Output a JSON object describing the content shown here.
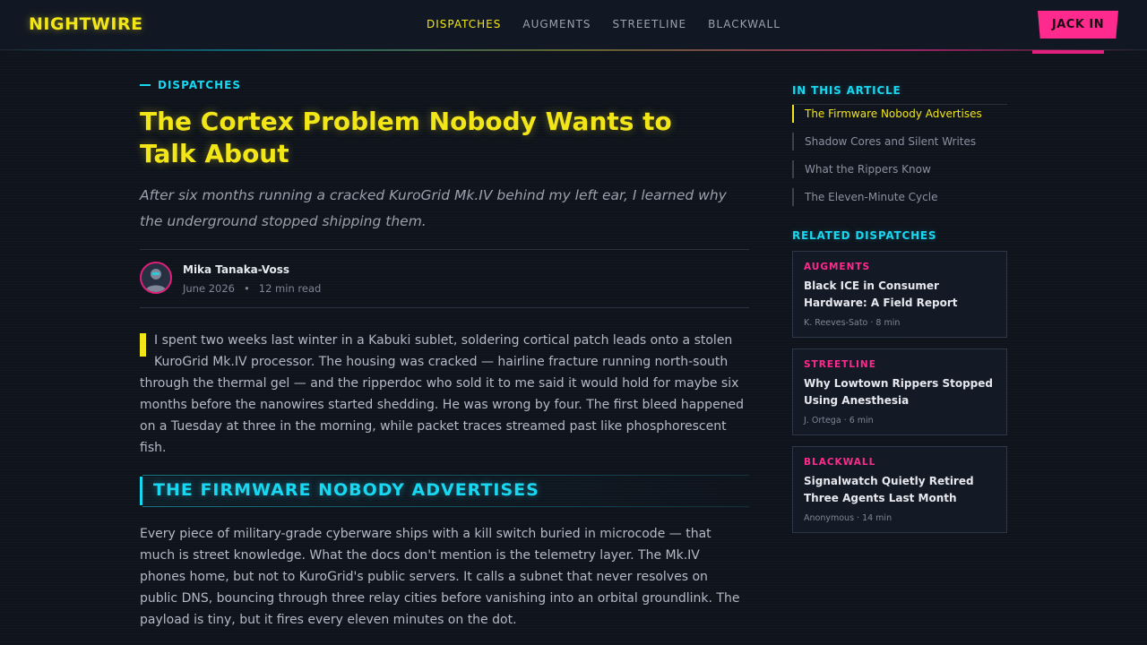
{
  "header": {
    "logo": "NIGHTWIRE",
    "nav": [
      {
        "label": "DISPATCHES",
        "active": true
      },
      {
        "label": "AUGMENTS",
        "active": false
      },
      {
        "label": "STREETLINE",
        "active": false
      },
      {
        "label": "BLACKWALL",
        "active": false
      }
    ],
    "cta_label": "JACK IN"
  },
  "article": {
    "kicker": "DISPATCHES",
    "title": "The Cortex Problem Nobody Wants to Talk About",
    "deck": "After six months running a cracked KuroGrid Mk.IV behind my left ear, I learned why the underground stopped shipping them.",
    "author": "Mika Tanaka-Voss",
    "date": "June 2026",
    "read_time": "12 min read",
    "lead": "I spent two weeks last winter in a Kabuki sublet, soldering cortical patch leads onto a stolen KuroGrid Mk.IV processor. The housing was cracked — hairline fracture running north-south through the thermal gel — and the ripperdoc who sold it to me said it would hold for maybe six months before the nanowires started shedding. He was wrong by four. The first bleed happened on a Tuesday at three in the morning, while packet traces streamed past like phosphorescent fish.",
    "section_heading": "THE FIRMWARE NOBODY ADVERTISES",
    "section_body": "Every piece of military-grade cyberware ships with a kill switch buried in microcode — that much is street knowledge. What the docs don't mention is the telemetry layer. The Mk.IV phones home, but not to KuroGrid's public servers. It calls a subnet that never resolves on public DNS, bouncing through three relay cities before vanishing into an orbital groundlink. The payload is tiny, but it fires every eleven minutes on the dot."
  },
  "sidebar": {
    "toc_title": "IN THIS ARTICLE",
    "toc": [
      {
        "label": "The Firmware Nobody Advertises",
        "active": true
      },
      {
        "label": "Shadow Cores and Silent Writes",
        "active": false
      },
      {
        "label": "What the Rippers Know",
        "active": false
      },
      {
        "label": "The Eleven-Minute Cycle",
        "active": false
      }
    ],
    "related_title": "RELATED DISPATCHES",
    "related": [
      {
        "category": "AUGMENTS",
        "title": "Black ICE in Consumer Hardware: A Field Report",
        "byline": "K. Reeves-Sato · 8 min"
      },
      {
        "category": "STREETLINE",
        "title": "Why Lowtown Rippers Stopped Using Anesthesia",
        "byline": "J. Ortega · 6 min"
      },
      {
        "category": "BLACKWALL",
        "title": "Signalwatch Quietly Retired Three Agents Last Month",
        "byline": "Anonymous · 14 min"
      }
    ]
  },
  "colors": {
    "accent_yellow": "#f2e619",
    "accent_cyan": "#19d7f0",
    "accent_pink": "#ff2a8e",
    "background": "#0e131c"
  }
}
